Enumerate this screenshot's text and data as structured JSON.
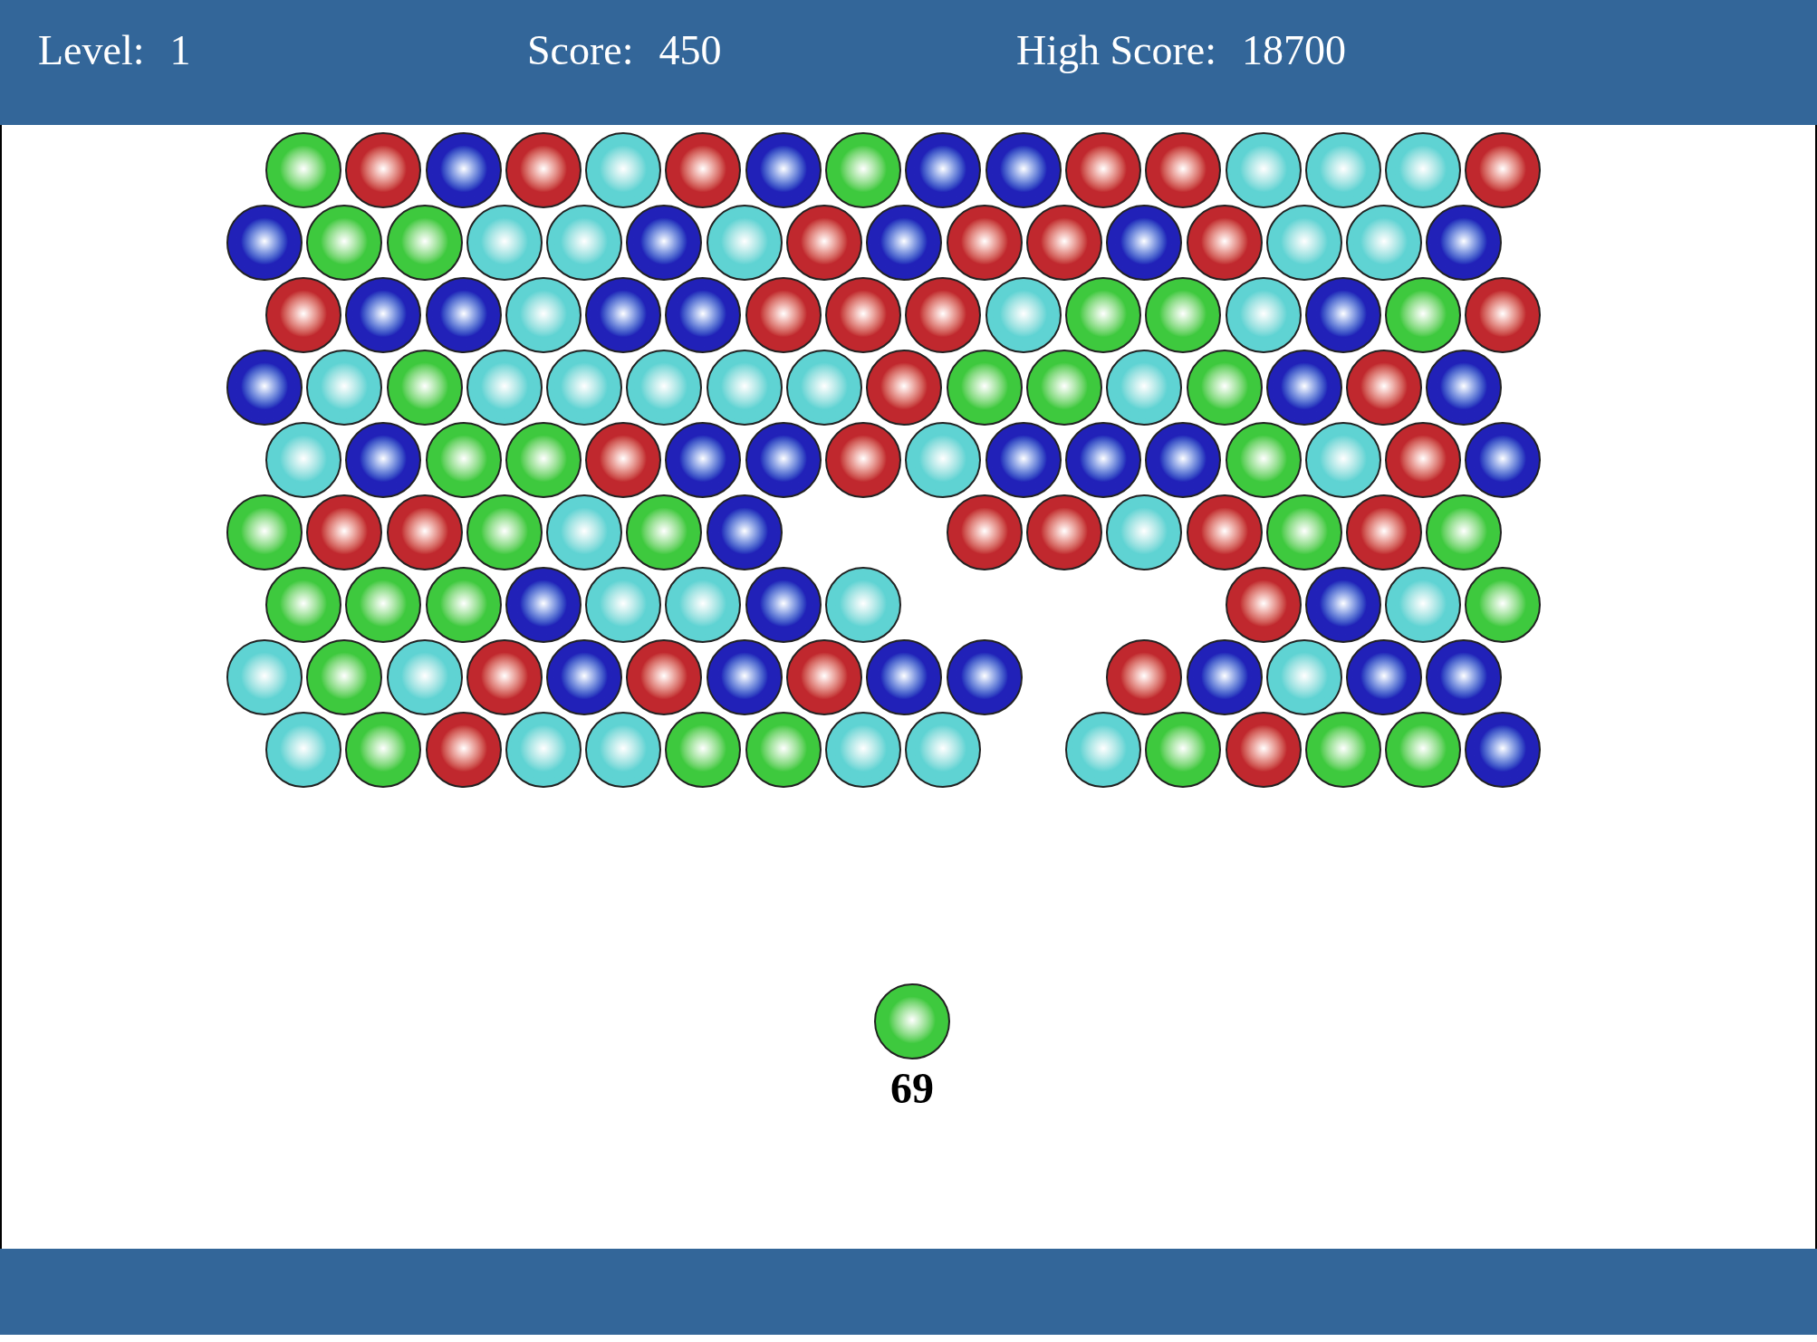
{
  "header": {
    "stats": [
      {
        "label": "Level:",
        "value": "1"
      },
      {
        "label": "Score:",
        "value": "450"
      },
      {
        "label": "High Score:",
        "value": "18700"
      }
    ]
  },
  "board": {
    "rows": [
      {
        "bubbles": [
          {
            "kind": "bubble",
            "color": "#3ec93e"
          },
          {
            "kind": "bubble",
            "color": "#c0282e"
          },
          {
            "kind": "bubble",
            "color": "#2121b8"
          },
          {
            "kind": "bubble",
            "color": "#c0282e"
          },
          {
            "kind": "bubble",
            "color": "#5fd3d3"
          },
          {
            "kind": "bubble",
            "color": "#c0282e"
          },
          {
            "kind": "bubble",
            "color": "#2121b8"
          },
          {
            "kind": "bubble",
            "color": "#3ec93e"
          },
          {
            "kind": "bubble",
            "color": "#2121b8"
          },
          {
            "kind": "bubble",
            "color": "#2121b8"
          },
          {
            "kind": "bubble",
            "color": "#c0282e"
          },
          {
            "kind": "bubble",
            "color": "#c0282e"
          },
          {
            "kind": "bubble",
            "color": "#5fd3d3"
          },
          {
            "kind": "bubble",
            "color": "#5fd3d3"
          },
          {
            "kind": "bubble",
            "color": "#5fd3d3"
          },
          {
            "kind": "bubble",
            "color": "#c0282e"
          }
        ]
      },
      {
        "bubbles": [
          {
            "kind": "bubble",
            "color": "#2121b8"
          },
          {
            "kind": "bubble",
            "color": "#3ec93e"
          },
          {
            "kind": "bubble",
            "color": "#3ec93e"
          },
          {
            "kind": "bubble",
            "color": "#5fd3d3"
          },
          {
            "kind": "bubble",
            "color": "#5fd3d3"
          },
          {
            "kind": "bubble",
            "color": "#2121b8"
          },
          {
            "kind": "bubble",
            "color": "#5fd3d3"
          },
          {
            "kind": "bubble",
            "color": "#c0282e"
          },
          {
            "kind": "bubble",
            "color": "#2121b8"
          },
          {
            "kind": "bubble",
            "color": "#c0282e"
          },
          {
            "kind": "bubble",
            "color": "#c0282e"
          },
          {
            "kind": "bubble",
            "color": "#2121b8"
          },
          {
            "kind": "bubble",
            "color": "#c0282e"
          },
          {
            "kind": "bubble",
            "color": "#5fd3d3"
          },
          {
            "kind": "bubble",
            "color": "#5fd3d3"
          },
          {
            "kind": "bubble",
            "color": "#2121b8"
          }
        ]
      },
      {
        "bubbles": [
          {
            "kind": "bubble",
            "color": "#c0282e"
          },
          {
            "kind": "bubble",
            "color": "#2121b8"
          },
          {
            "kind": "bubble",
            "color": "#2121b8"
          },
          {
            "kind": "bubble",
            "color": "#5fd3d3"
          },
          {
            "kind": "bubble",
            "color": "#2121b8"
          },
          {
            "kind": "bubble",
            "color": "#2121b8"
          },
          {
            "kind": "bubble",
            "color": "#c0282e"
          },
          {
            "kind": "bubble",
            "color": "#c0282e"
          },
          {
            "kind": "bubble",
            "color": "#c0282e"
          },
          {
            "kind": "bubble",
            "color": "#5fd3d3"
          },
          {
            "kind": "bubble",
            "color": "#3ec93e"
          },
          {
            "kind": "bubble",
            "color": "#3ec93e"
          },
          {
            "kind": "bubble",
            "color": "#5fd3d3"
          },
          {
            "kind": "bubble",
            "color": "#2121b8"
          },
          {
            "kind": "bubble",
            "color": "#3ec93e"
          },
          {
            "kind": "bubble",
            "color": "#c0282e"
          }
        ]
      },
      {
        "bubbles": [
          {
            "kind": "bubble",
            "color": "#2121b8"
          },
          {
            "kind": "bubble",
            "color": "#5fd3d3"
          },
          {
            "kind": "bubble",
            "color": "#3ec93e"
          },
          {
            "kind": "bubble",
            "color": "#5fd3d3"
          },
          {
            "kind": "bubble",
            "color": "#5fd3d3"
          },
          {
            "kind": "bubble",
            "color": "#5fd3d3"
          },
          {
            "kind": "bubble",
            "color": "#5fd3d3"
          },
          {
            "kind": "bubble",
            "color": "#5fd3d3"
          },
          {
            "kind": "bubble",
            "color": "#c0282e"
          },
          {
            "kind": "bubble",
            "color": "#3ec93e"
          },
          {
            "kind": "bubble",
            "color": "#3ec93e"
          },
          {
            "kind": "bubble",
            "color": "#5fd3d3"
          },
          {
            "kind": "bubble",
            "color": "#3ec93e"
          },
          {
            "kind": "bubble",
            "color": "#2121b8"
          },
          {
            "kind": "bubble",
            "color": "#c0282e"
          },
          {
            "kind": "bubble",
            "color": "#2121b8"
          }
        ]
      },
      {
        "bubbles": [
          {
            "kind": "bubble",
            "color": "#5fd3d3"
          },
          {
            "kind": "bubble",
            "color": "#2121b8"
          },
          {
            "kind": "bubble",
            "color": "#3ec93e"
          },
          {
            "kind": "bubble",
            "color": "#3ec93e"
          },
          {
            "kind": "bubble",
            "color": "#c0282e"
          },
          {
            "kind": "bubble",
            "color": "#2121b8"
          },
          {
            "kind": "bubble",
            "color": "#2121b8"
          },
          {
            "kind": "bubble",
            "color": "#c0282e"
          },
          {
            "kind": "bubble",
            "color": "#5fd3d3"
          },
          {
            "kind": "bubble",
            "color": "#2121b8"
          },
          {
            "kind": "bubble",
            "color": "#2121b8"
          },
          {
            "kind": "bubble",
            "color": "#2121b8"
          },
          {
            "kind": "bubble",
            "color": "#3ec93e"
          },
          {
            "kind": "bubble",
            "color": "#5fd3d3"
          },
          {
            "kind": "bubble",
            "color": "#c0282e"
          },
          {
            "kind": "bubble",
            "color": "#2121b8"
          }
        ]
      },
      {
        "bubbles": [
          {
            "kind": "bubble",
            "color": "#3ec93e"
          },
          {
            "kind": "bubble",
            "color": "#c0282e"
          },
          {
            "kind": "bubble",
            "color": "#c0282e"
          },
          {
            "kind": "bubble",
            "color": "#3ec93e"
          },
          {
            "kind": "bubble",
            "color": "#5fd3d3"
          },
          {
            "kind": "bubble",
            "color": "#3ec93e"
          },
          {
            "kind": "bubble",
            "color": "#2121b8"
          },
          {
            "kind": "empty"
          },
          {
            "kind": "empty"
          },
          {
            "kind": "bubble",
            "color": "#c0282e"
          },
          {
            "kind": "bubble",
            "color": "#c0282e"
          },
          {
            "kind": "bubble",
            "color": "#5fd3d3"
          },
          {
            "kind": "bubble",
            "color": "#c0282e"
          },
          {
            "kind": "bubble",
            "color": "#3ec93e"
          },
          {
            "kind": "bubble",
            "color": "#c0282e"
          },
          {
            "kind": "bubble",
            "color": "#3ec93e"
          }
        ]
      },
      {
        "bubbles": [
          {
            "kind": "bubble",
            "color": "#3ec93e"
          },
          {
            "kind": "bubble",
            "color": "#3ec93e"
          },
          {
            "kind": "bubble",
            "color": "#3ec93e"
          },
          {
            "kind": "bubble",
            "color": "#2121b8"
          },
          {
            "kind": "bubble",
            "color": "#5fd3d3"
          },
          {
            "kind": "bubble",
            "color": "#5fd3d3"
          },
          {
            "kind": "bubble",
            "color": "#2121b8"
          },
          {
            "kind": "bubble",
            "color": "#5fd3d3"
          },
          {
            "kind": "empty"
          },
          {
            "kind": "empty"
          },
          {
            "kind": "empty"
          },
          {
            "kind": "empty"
          },
          {
            "kind": "bubble",
            "color": "#c0282e"
          },
          {
            "kind": "bubble",
            "color": "#2121b8"
          },
          {
            "kind": "bubble",
            "color": "#5fd3d3"
          },
          {
            "kind": "bubble",
            "color": "#3ec93e"
          }
        ]
      },
      {
        "bubbles": [
          {
            "kind": "bubble",
            "color": "#5fd3d3"
          },
          {
            "kind": "bubble",
            "color": "#3ec93e"
          },
          {
            "kind": "bubble",
            "color": "#5fd3d3"
          },
          {
            "kind": "bubble",
            "color": "#c0282e"
          },
          {
            "kind": "bubble",
            "color": "#2121b8"
          },
          {
            "kind": "bubble",
            "color": "#c0282e"
          },
          {
            "kind": "bubble",
            "color": "#2121b8"
          },
          {
            "kind": "bubble",
            "color": "#c0282e"
          },
          {
            "kind": "bubble",
            "color": "#2121b8"
          },
          {
            "kind": "bubble",
            "color": "#2121b8"
          },
          {
            "kind": "empty"
          },
          {
            "kind": "bubble",
            "color": "#c0282e"
          },
          {
            "kind": "bubble",
            "color": "#2121b8"
          },
          {
            "kind": "bubble",
            "color": "#5fd3d3"
          },
          {
            "kind": "bubble",
            "color": "#2121b8"
          },
          {
            "kind": "bubble",
            "color": "#2121b8"
          }
        ]
      },
      {
        "bubbles": [
          {
            "kind": "bubble",
            "color": "#5fd3d3"
          },
          {
            "kind": "bubble",
            "color": "#3ec93e"
          },
          {
            "kind": "bubble",
            "color": "#c0282e"
          },
          {
            "kind": "bubble",
            "color": "#5fd3d3"
          },
          {
            "kind": "bubble",
            "color": "#5fd3d3"
          },
          {
            "kind": "bubble",
            "color": "#3ec93e"
          },
          {
            "kind": "bubble",
            "color": "#3ec93e"
          },
          {
            "kind": "bubble",
            "color": "#5fd3d3"
          },
          {
            "kind": "bubble",
            "color": "#5fd3d3"
          },
          {
            "kind": "empty"
          },
          {
            "kind": "bubble",
            "color": "#5fd3d3"
          },
          {
            "kind": "bubble",
            "color": "#3ec93e"
          },
          {
            "kind": "bubble",
            "color": "#c0282e"
          },
          {
            "kind": "bubble",
            "color": "#3ec93e"
          },
          {
            "kind": "bubble",
            "color": "#3ec93e"
          },
          {
            "kind": "bubble",
            "color": "#2121b8"
          }
        ]
      }
    ]
  },
  "shooter": {
    "color": "#3ec93e",
    "remaining": "69"
  }
}
